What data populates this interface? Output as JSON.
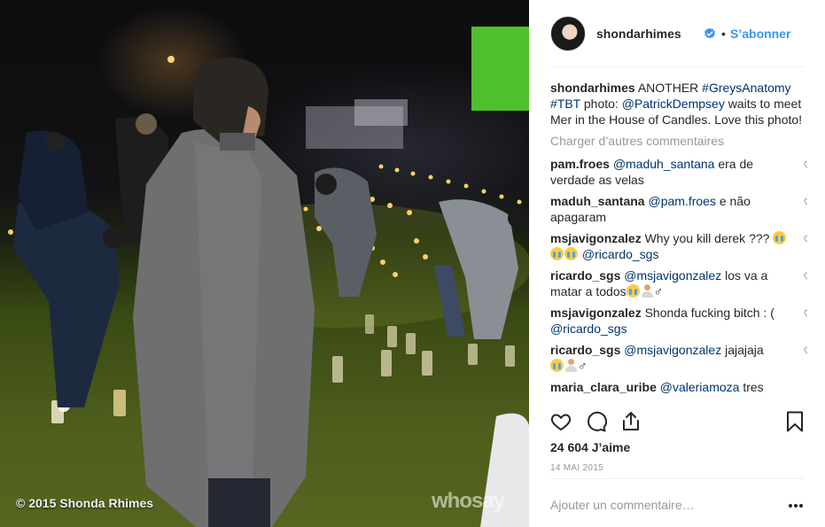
{
  "photo": {
    "copyright": "© 2015 Shonda Rhimes",
    "watermark": "whosay"
  },
  "header": {
    "username": "shondarhimes",
    "separator": "•",
    "follow_label": "S’abonner",
    "verified_icon": "verified-badge-icon",
    "verified_color": "#3897f0"
  },
  "caption": {
    "username": "shondarhimes",
    "text_1": "ANOTHER",
    "tag_1": "#GreysAnatomy",
    "tag_2": "#TBT",
    "text_2": "photo:",
    "mention_1": "@PatrickDempsey",
    "text_3": "waits to meet Mer in the House of Candles. Love this photo!"
  },
  "load_more": "Charger d’autres commentaires",
  "comments": [
    {
      "user": "pam.froes",
      "mention": "@maduh_santana",
      "text": "era de verdade as velas"
    },
    {
      "user": "maduh_santana",
      "mention": "@pam.froes",
      "text": "e não apagaram"
    },
    {
      "user": "msjavigonzalez",
      "pre": "Why you kill derek ???",
      "mention": "@ricardo_sgs"
    },
    {
      "user": "ricardo_sgs",
      "mention": "@msjavigonzalez",
      "text": "los va a matar a todos",
      "tail": "♂"
    },
    {
      "user": "msjavigonzalez",
      "pre": "Shonda fucking bitch : (",
      "mention": "@ricardo_sgs"
    },
    {
      "user": "ricardo_sgs",
      "mention": "@msjavigonzalez",
      "text": "jajajaja",
      "tail": "♂"
    },
    {
      "user": "maria_clara_uribe",
      "mention": "@valeriamoza",
      "text": "tres"
    }
  ],
  "actions": {
    "like_icon": "heart-icon",
    "comment_icon": "comment-icon",
    "share_icon": "share-icon",
    "save_icon": "bookmark-icon"
  },
  "likes": "24 604 J’aime",
  "date": "14 MAI 2015",
  "add_comment": {
    "placeholder": "Ajouter un commentaire…"
  },
  "colors": {
    "link": "#003569",
    "accent": "#3897f0",
    "muted": "#999999",
    "text": "#262626"
  }
}
